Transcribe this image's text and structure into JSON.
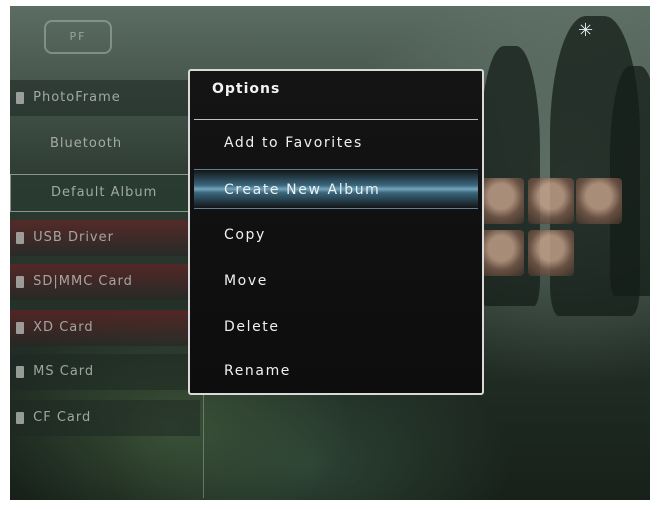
{
  "top_bar": {
    "logo_text": "PF",
    "bluetooth_icon": "bluetooth-icon"
  },
  "sidebar": {
    "items": [
      {
        "label": "PhotoFrame",
        "icon": "photoframe-icon"
      },
      {
        "label": "Bluetooth"
      },
      {
        "label": "Default Album",
        "selected": true
      },
      {
        "label": "USB Driver",
        "icon": "usb-icon"
      },
      {
        "label": "SD|MMC Card",
        "icon": "card-icon"
      },
      {
        "label": "XD Card",
        "icon": "card-icon"
      },
      {
        "label": "MS Card",
        "icon": "card-icon"
      },
      {
        "label": "CF Card",
        "icon": "card-icon"
      }
    ]
  },
  "options_menu": {
    "title": "Options",
    "items": [
      {
        "label": "Add to Favorites"
      },
      {
        "label": "Create New Album",
        "highlighted": true
      },
      {
        "label": "Copy"
      },
      {
        "label": "Move"
      },
      {
        "label": "Delete"
      },
      {
        "label": "Rename"
      }
    ]
  },
  "colors": {
    "menu_background": "#111111",
    "menu_border": "#d9d9d9",
    "highlight": "#7cc3e6"
  }
}
